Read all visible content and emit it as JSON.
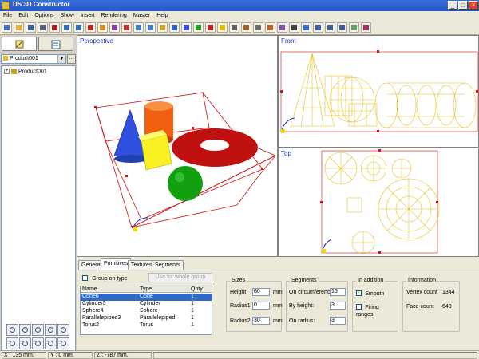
{
  "window": {
    "title": "DS 3D Constructor",
    "minimize": "_",
    "maximize": "□",
    "close": "×"
  },
  "menu": [
    "File",
    "Edit",
    "Options",
    "Show",
    "Insert",
    "Rendering",
    "Master",
    "Help"
  ],
  "left": {
    "combo_value": "Product001",
    "combo_button": "...",
    "tree_expander": "+",
    "tree_root": "Product001"
  },
  "viewports": {
    "perspective": "Perspective",
    "front": "Front",
    "top": "Top"
  },
  "bottom": {
    "tabs": [
      "General",
      "Primitives",
      "Textures",
      "Segments"
    ],
    "active_tab": "Primitives",
    "group_on_type_label": "Group on type",
    "use_whole_group_button": "Use for whole group",
    "table": {
      "headers": [
        "Name",
        "Type",
        "Qnty"
      ],
      "rows": [
        [
          "Cone6",
          "Cone",
          "1"
        ],
        [
          "Cylinder5",
          "Cylinder",
          "1"
        ],
        [
          "Sphere4",
          "Sphere",
          "1"
        ],
        [
          "Parallelepiped3",
          "Parallelepiped",
          "1"
        ],
        [
          "Torus2",
          "Torus",
          "1"
        ]
      ],
      "selected_row": 0
    },
    "sizes": {
      "title": "Sizes",
      "height_label": "Height",
      "height_value": "60",
      "height_unit": "mm",
      "radius1_label": "Radius1",
      "radius1_value": "0",
      "radius1_unit": "mm",
      "radius2_label": "Radius2",
      "radius2_value": "30",
      "radius2_unit": "mm"
    },
    "segments": {
      "title": "Segments",
      "circumference_label": "On circumference",
      "circumference_value": "15",
      "height_label": "By height:",
      "height_value": "3",
      "radius_label": "On radius:",
      "radius_value": "3"
    },
    "addition": {
      "title": "In addition",
      "smooth_label": "Smooth",
      "smooth_checked": true,
      "firing_label": "Firing ranges",
      "firing_checked": false
    },
    "information": {
      "title": "Information",
      "vertex_label": "Vertex count",
      "vertex_value": "1344",
      "face_label": "Face count",
      "face_value": "640"
    }
  },
  "status": {
    "x": "X : 135 mm.",
    "y": "Y : 0 mm.",
    "z": "Z : -787 mm."
  },
  "colors": {
    "selection": "#316ac5",
    "bbox": "#d01010",
    "wireframe": "#e8c020",
    "viewport_title": "#1030d0",
    "cone": "#3050e0",
    "cylinder": "#f06010",
    "box": "#f8f020",
    "torus": "#c01010",
    "sphere": "#10a010"
  },
  "icons": {
    "toolbar": [
      "new-icon",
      "open-icon",
      "undo-icon",
      "redo-icon",
      "cut-icon",
      "copy-icon",
      "paste-icon",
      "delete-icon",
      "group-icon",
      "ungroup-icon",
      "render-icon",
      "import-icon",
      "export-icon",
      "box-icon",
      "cylinder-icon",
      "cone-icon",
      "sphere-icon",
      "torus-icon",
      "light-icon",
      "camera-icon",
      "measure-icon",
      "grid-icon",
      "texture-icon",
      "material-icon",
      "wireframe-icon",
      "shade-icon",
      "layout-1-icon",
      "layout-2-icon",
      "layout-4-icon",
      "calc-icon",
      "report-icon"
    ],
    "nav": [
      "zoom-window-icon",
      "pan-icon",
      "zoom-extents-icon",
      "zoom-in-icon",
      "zoom-out-icon",
      "rotate-icon",
      "orbit-icon",
      "zoom-all-icon",
      "zoom-selected-icon",
      "zoom-previous-icon"
    ]
  }
}
